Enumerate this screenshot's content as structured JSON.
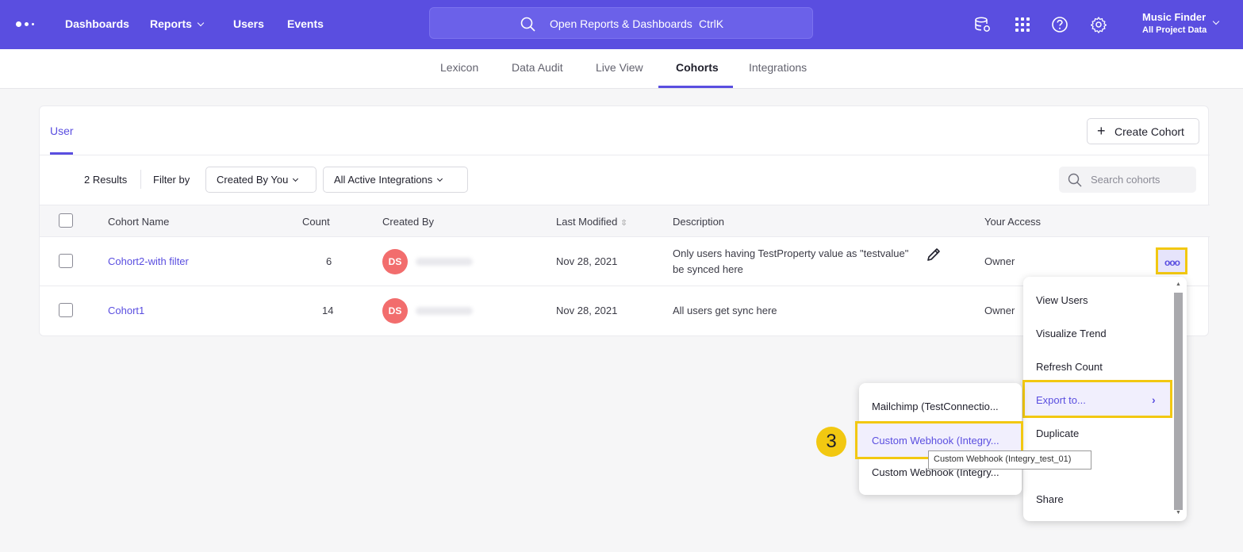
{
  "topnav": {
    "links": [
      "Dashboards",
      "Reports",
      "Users",
      "Events"
    ],
    "search_text": "Open Reports & Dashboards",
    "search_shortcut": "CtrlK",
    "project_name": "Music Finder",
    "project_scope": "All Project Data",
    "icons": [
      "database-settings-icon",
      "apps-grid-icon",
      "help-icon",
      "settings-icon"
    ]
  },
  "subnav": {
    "tabs": [
      "Lexicon",
      "Data Audit",
      "Live View",
      "Cohorts",
      "Integrations"
    ],
    "active": "Cohorts"
  },
  "card": {
    "tab": "User",
    "create_label": "Create Cohort",
    "results": "2 Results",
    "filter_by": "Filter by",
    "filter_created": "Created By You",
    "filter_integrations": "All Active Integrations",
    "search_placeholder": "Search cohorts"
  },
  "table": {
    "headers": {
      "name": "Cohort Name",
      "count": "Count",
      "created_by": "Created By",
      "last_modified": "Last Modified",
      "description": "Description",
      "access": "Your Access"
    },
    "rows": [
      {
        "name": "Cohort2-with filter",
        "count": "6",
        "avatar": "DS",
        "modified": "Nov 28, 2021",
        "description_line1": "Only users having TestProperty value as \"testvalue\"",
        "description_line2": "be synced here",
        "access": "Owner"
      },
      {
        "name": "Cohort1",
        "count": "14",
        "avatar": "DS",
        "modified": "Nov 28, 2021",
        "description_line1": "All users get sync here",
        "access": "Owner"
      }
    ]
  },
  "menu": {
    "items": [
      "View Users",
      "Visualize Trend",
      "Refresh Count",
      "Export to...",
      "Duplicate",
      "Share"
    ]
  },
  "submenu": {
    "items": [
      "Mailchimp (TestConnectio...",
      "Custom Webhook (Integry...",
      "Custom Webhook (Integry..."
    ],
    "tooltip": "Custom Webhook (Integry_test_01)"
  },
  "annotation": {
    "step": "3",
    "highlight_color": "#f2c811"
  },
  "colors": {
    "brand": "#5a4ee0",
    "avatar": "#f26d6d"
  }
}
